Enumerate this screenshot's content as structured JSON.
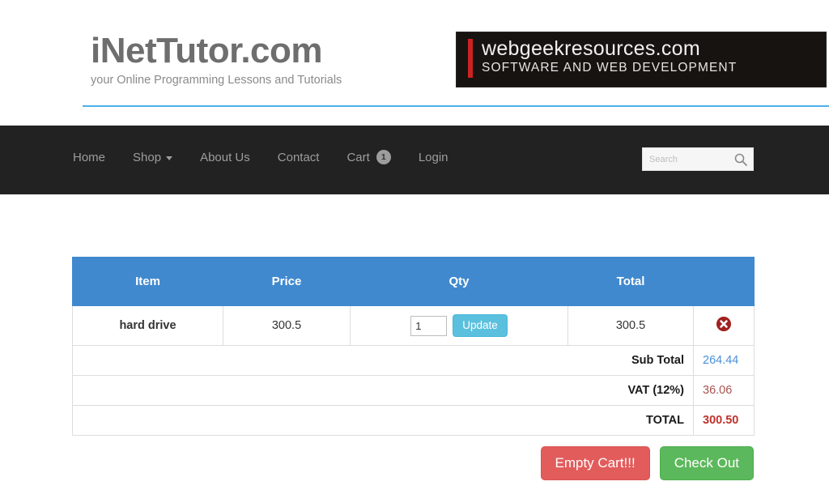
{
  "header": {
    "logo_main": "iNetTutor.com",
    "logo_sub": "your Online Programming Lessons and Tutorials",
    "ad_line1": "webgeekresources.com",
    "ad_line2": "SOFTWARE AND WEB DEVELOPMENT"
  },
  "nav": {
    "items": [
      {
        "label": "Home"
      },
      {
        "label": "Shop"
      },
      {
        "label": "About Us"
      },
      {
        "label": "Contact"
      },
      {
        "label": "Cart"
      },
      {
        "label": "Login"
      }
    ],
    "cart_badge": "1"
  },
  "search": {
    "placeholder": "Search",
    "value": "",
    "icon": "search-icon"
  },
  "cart": {
    "columns": [
      "Item",
      "Price",
      "Qty",
      "Total",
      ""
    ],
    "rows": [
      {
        "item": "hard drive",
        "price": "300.5",
        "qty": "1",
        "update_label": "Update",
        "total": "300.5",
        "delete_icon": "remove-circle-icon"
      }
    ],
    "summary": [
      {
        "label": "Sub Total",
        "value": "264.44"
      },
      {
        "label": "VAT (12%)",
        "value": "36.06"
      },
      {
        "label": "TOTAL",
        "value": "300.50"
      }
    ],
    "empty_cart_label": "Empty Cart!!!",
    "checkout_label": "Check Out"
  },
  "colors": {
    "table_header": "#4089ce",
    "nav_bg": "#222222",
    "rule": "#4cb0ea",
    "subtotal": "#4a90d9",
    "vat": "#a8534f",
    "total": "#c0322b",
    "empty_cart": "#e25c5c",
    "checkout": "#5cb85c",
    "update": "#5bc0de",
    "delete": "#a02020"
  }
}
